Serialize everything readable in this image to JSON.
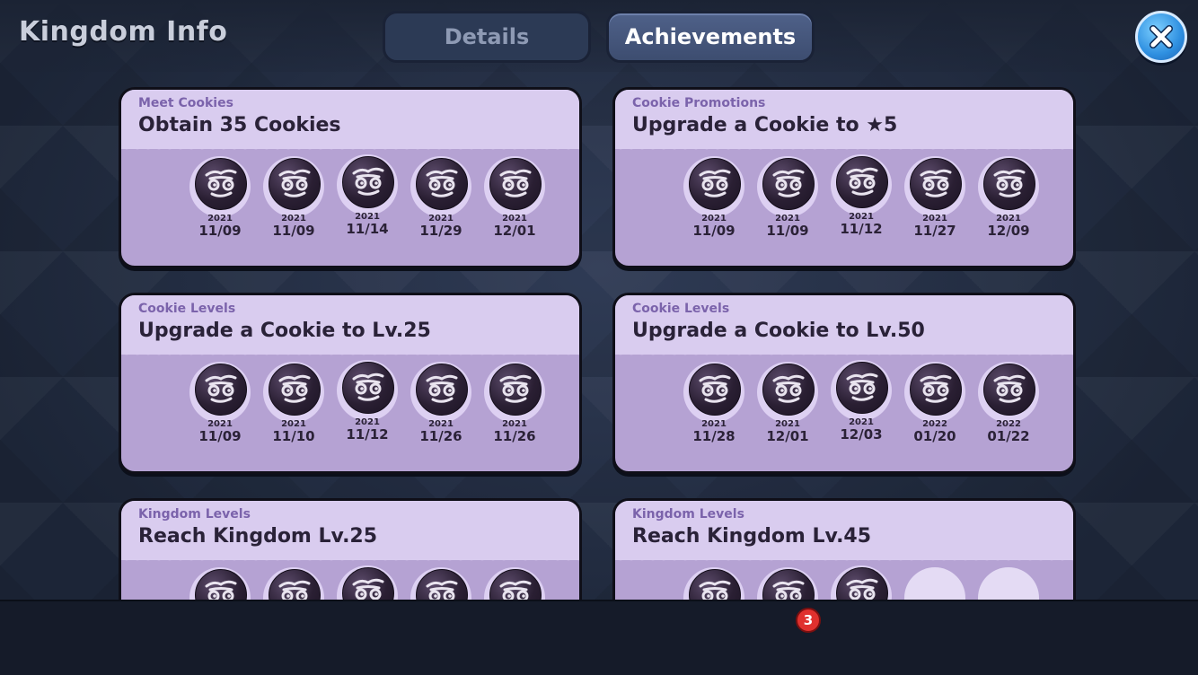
{
  "header": {
    "title": "Kingdom Info"
  },
  "icons": {
    "close": "close-icon",
    "cookie_face": "cookie-face-icon"
  },
  "colors": {
    "card_bg": "#b5a2d3",
    "card_head": "#d9ccef",
    "tab_active": "#4f6189",
    "badge_red": "#e0312e"
  },
  "achievements": [
    {
      "category": "Meet Cookies",
      "title": "Obtain 35 Cookies",
      "milestones": [
        {
          "year": "2021",
          "date": "11/09"
        },
        {
          "year": "2021",
          "date": "11/09"
        },
        {
          "year": "2021",
          "date": "11/14"
        },
        {
          "year": "2021",
          "date": "11/29"
        },
        {
          "year": "2021",
          "date": "12/01"
        }
      ]
    },
    {
      "category": "Cookie Promotions",
      "title": "Upgrade a Cookie to ★5",
      "milestones": [
        {
          "year": "2021",
          "date": "11/09"
        },
        {
          "year": "2021",
          "date": "11/09"
        },
        {
          "year": "2021",
          "date": "11/12"
        },
        {
          "year": "2021",
          "date": "11/27"
        },
        {
          "year": "2021",
          "date": "12/09"
        }
      ]
    },
    {
      "category": "Cookie Levels",
      "title": "Upgrade a Cookie to Lv.25",
      "milestones": [
        {
          "year": "2021",
          "date": "11/09"
        },
        {
          "year": "2021",
          "date": "11/10"
        },
        {
          "year": "2021",
          "date": "11/12"
        },
        {
          "year": "2021",
          "date": "11/26"
        },
        {
          "year": "2021",
          "date": "11/26"
        }
      ]
    },
    {
      "category": "Cookie Levels",
      "title": "Upgrade a Cookie to Lv.50",
      "milestones": [
        {
          "year": "2021",
          "date": "11/28"
        },
        {
          "year": "2021",
          "date": "12/01"
        },
        {
          "year": "2021",
          "date": "12/03"
        },
        {
          "year": "2022",
          "date": "01/20"
        },
        {
          "year": "2022",
          "date": "01/22"
        }
      ]
    },
    {
      "category": "Kingdom Levels",
      "title": "Reach Kingdom Lv.25",
      "milestones": [
        {
          "year": "",
          "date": ""
        },
        {
          "year": "",
          "date": ""
        },
        {
          "year": "",
          "date": ""
        },
        {
          "year": "",
          "date": ""
        },
        {
          "year": "",
          "date": ""
        }
      ]
    },
    {
      "category": "Kingdom Levels",
      "title": "Reach Kingdom Lv.45",
      "milestones": [
        {
          "year": "",
          "date": ""
        },
        {
          "year": "",
          "date": ""
        },
        {
          "year": "",
          "date": ""
        },
        {
          "empty": true
        },
        {
          "empty": true
        }
      ]
    }
  ],
  "tabs": {
    "details": "Details",
    "achievements": "Achievements",
    "achievements_badge": "3"
  }
}
